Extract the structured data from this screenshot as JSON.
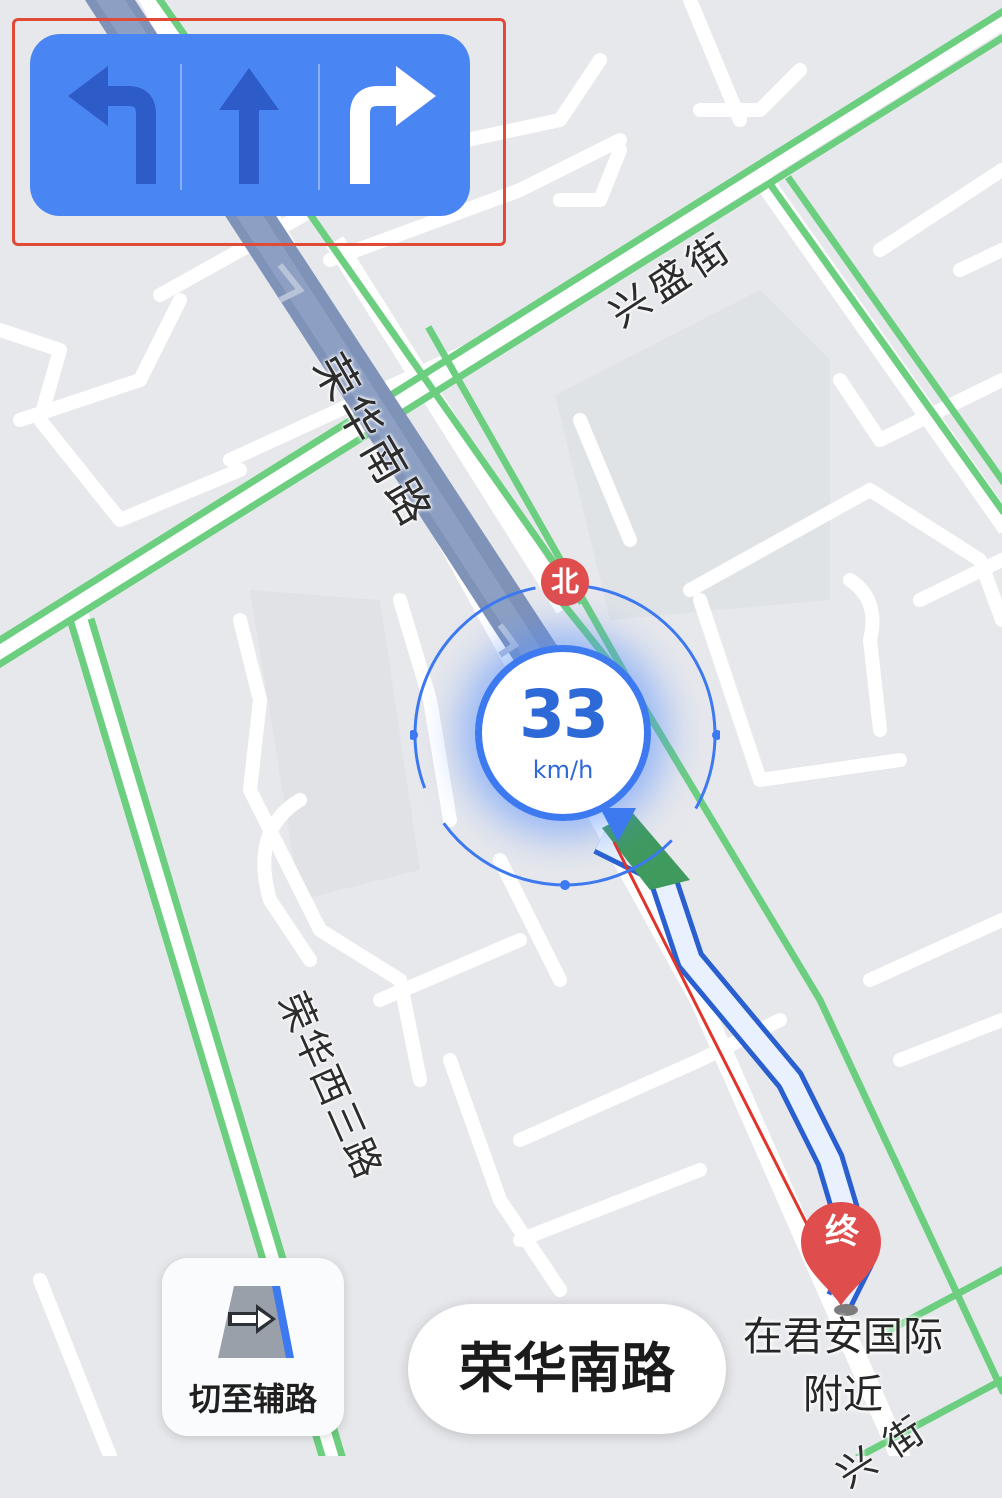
{
  "lane_guidance": {
    "lanes": [
      {
        "direction": "left",
        "icon": "turn-left-arrow-icon",
        "recommended": false
      },
      {
        "direction": "straight",
        "icon": "straight-arrow-icon",
        "recommended": false
      },
      {
        "direction": "right",
        "icon": "turn-right-arrow-icon",
        "recommended": true
      }
    ],
    "colors": {
      "panel": "#4a86f3",
      "recommended": "#ffffff",
      "other": "#2d5cc9"
    }
  },
  "map": {
    "road_labels": {
      "main_road": "荣华南路",
      "cross_street": "兴盛街",
      "west_road": "荣华西三路",
      "bottom_street": "兴街"
    },
    "compass": {
      "north_label": "北"
    },
    "colors": {
      "smooth_traffic": "#6ccf80",
      "route": "#3d7af0",
      "background": "#e7e8ec"
    }
  },
  "speed": {
    "value": "33",
    "unit": "km/h"
  },
  "destination": {
    "marker_label": "终",
    "caption_line1": "在君安国际",
    "caption_line2": "附近"
  },
  "controls": {
    "switch_road_label": "切至辅路",
    "switch_road_icon": "side-road-switch-icon"
  },
  "current_road": {
    "name": "荣华南路"
  }
}
